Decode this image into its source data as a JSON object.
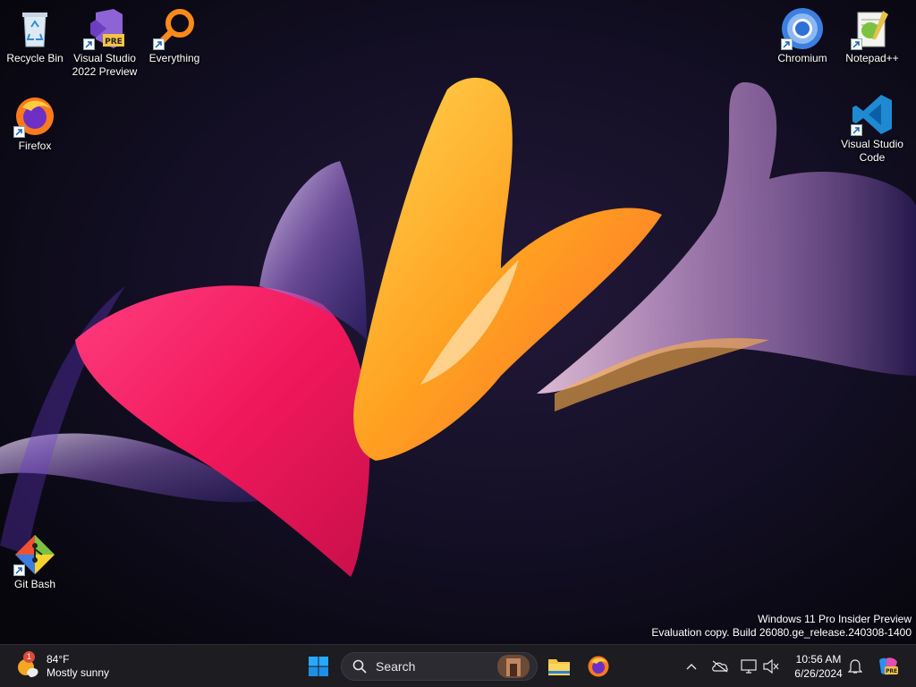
{
  "desktop": {
    "icons": [
      {
        "label_line1": "Recycle Bin",
        "label_line2": "",
        "icon": "recycle-bin-icon"
      },
      {
        "label_line1": "Visual Studio",
        "label_line2": "2022 Preview",
        "icon": "visual-studio-preview-icon",
        "badge": "PRE"
      },
      {
        "label_line1": "Everything",
        "label_line2": "",
        "icon": "everything-search-icon"
      },
      {
        "label_line1": "Chromium",
        "label_line2": "",
        "icon": "chromium-icon"
      },
      {
        "label_line1": "Notepad++",
        "label_line2": "",
        "icon": "notepad-plus-plus-icon"
      },
      {
        "label_line1": "Firefox",
        "label_line2": "",
        "icon": "firefox-icon"
      },
      {
        "label_line1": "Visual Studio",
        "label_line2": "Code",
        "icon": "vscode-icon"
      },
      {
        "label_line1": "Git Bash",
        "label_line2": "",
        "icon": "git-bash-icon"
      }
    ]
  },
  "watermark": {
    "line1": "Windows 11 Pro Insider Preview",
    "line2": "Evaluation copy. Build 26080.ge_release.240308-1400"
  },
  "taskbar": {
    "weather": {
      "temp": "84°F",
      "condition": "Mostly sunny",
      "badge": "1",
      "icon": "weather-sun-icon"
    },
    "start_icon": "windows-start-icon",
    "search": {
      "label": "Search",
      "icon": "search-icon"
    },
    "pinned": [
      "file-explorer-icon",
      "firefox-icon"
    ],
    "tray": [
      "chevron-up-icon",
      "onedrive-offline-icon",
      "display-icon",
      "mute-icon",
      "bell-icon",
      "copilot-icon"
    ],
    "clock": {
      "time": "10:56 AM",
      "date": "6/26/2024"
    },
    "colors": {
      "background": "#1c1c21",
      "accent": "#0078d4"
    }
  }
}
